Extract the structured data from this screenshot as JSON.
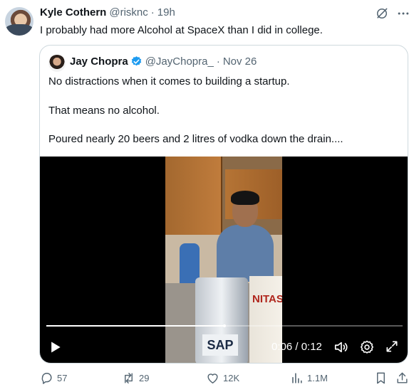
{
  "tweet": {
    "author_name": "Kyle Cothern",
    "author_handle": "@risknc",
    "separator": "·",
    "time": "19h",
    "text": "I probably had more Alcohol at SpaceX than I did in college."
  },
  "quote": {
    "author_name": "Jay Chopra",
    "author_handle": "@JayChopra_",
    "separator": "·",
    "date": "Nov 26",
    "lines": [
      "No distractions when it comes to building a startup.",
      "That means no alcohol.",
      "Poured nearly 20 beers and 2 litres of vodka down the drain...."
    ],
    "verified_color": "#1d9bf0"
  },
  "video": {
    "time_display": "0:06 / 0:12",
    "progress": 0.5,
    "can_label_left": "SAP",
    "can_label_right": "NITAS"
  },
  "actions": {
    "replies": "57",
    "reposts": "29",
    "likes": "12K",
    "views": "1.1M"
  },
  "colors": {
    "text_primary": "#0f1419",
    "text_secondary": "#536471",
    "border": "#cfd9de"
  }
}
